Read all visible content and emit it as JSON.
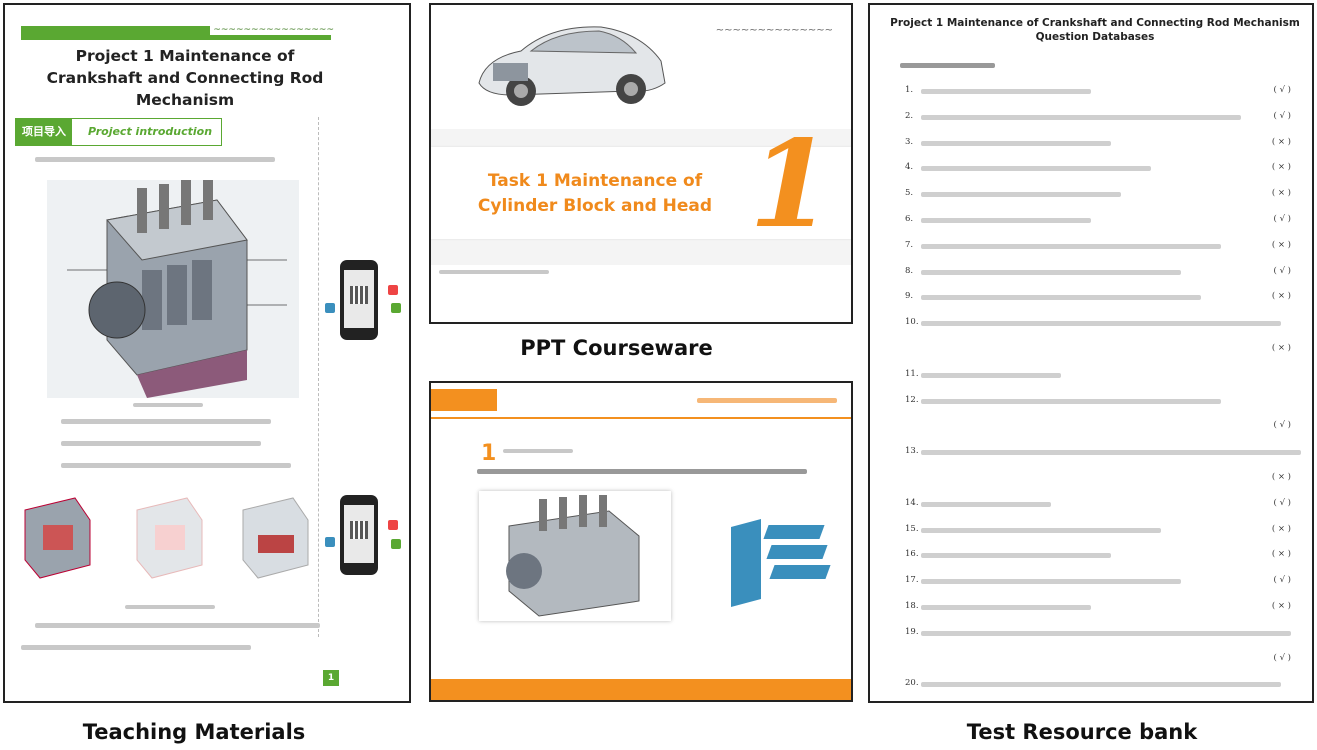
{
  "captions": {
    "teaching": "Teaching Materials",
    "ppt": "PPT Courseware",
    "test": "Test Resource bank"
  },
  "teaching_materials": {
    "title": "Project 1 Maintenance of Crankshaft and Connecting Rod Mechanism",
    "intro_cn": "项目导入",
    "intro_en": "Project  introduction",
    "page": "1"
  },
  "ppt_top": {
    "title": "Task 1 Maintenance of Cylinder Block and Head",
    "big_number": "1"
  },
  "test_bank": {
    "title": "Project 1 Maintenance of Crankshaft and Connecting Rod Mechanism  Question Databases",
    "items": [
      {
        "num": "1.",
        "ans": "( √ )"
      },
      {
        "num": "2.",
        "ans": "( √ )"
      },
      {
        "num": "3.",
        "ans": "( × )"
      },
      {
        "num": "4.",
        "ans": "( × )"
      },
      {
        "num": "5.",
        "ans": "( × )"
      },
      {
        "num": "6.",
        "ans": "( √ )"
      },
      {
        "num": "7.",
        "ans": "( × )"
      },
      {
        "num": "8.",
        "ans": "( √ )"
      },
      {
        "num": "9.",
        "ans": "( × )"
      },
      {
        "num": "10.",
        "ans": ""
      },
      {
        "num": "",
        "ans": "( × )"
      },
      {
        "num": "11.",
        "ans": ""
      },
      {
        "num": "12.",
        "ans": ""
      },
      {
        "num": "",
        "ans": "( √ )"
      },
      {
        "num": "13.",
        "ans": ""
      },
      {
        "num": "",
        "ans": "( × )"
      },
      {
        "num": "14.",
        "ans": "( √ )"
      },
      {
        "num": "15.",
        "ans": "( × )"
      },
      {
        "num": "16.",
        "ans": "( × )"
      },
      {
        "num": "17.",
        "ans": "( √ )"
      },
      {
        "num": "18.",
        "ans": "( × )"
      },
      {
        "num": "19.",
        "ans": ""
      },
      {
        "num": "",
        "ans": "( √ )"
      },
      {
        "num": "20.",
        "ans": ""
      }
    ]
  }
}
